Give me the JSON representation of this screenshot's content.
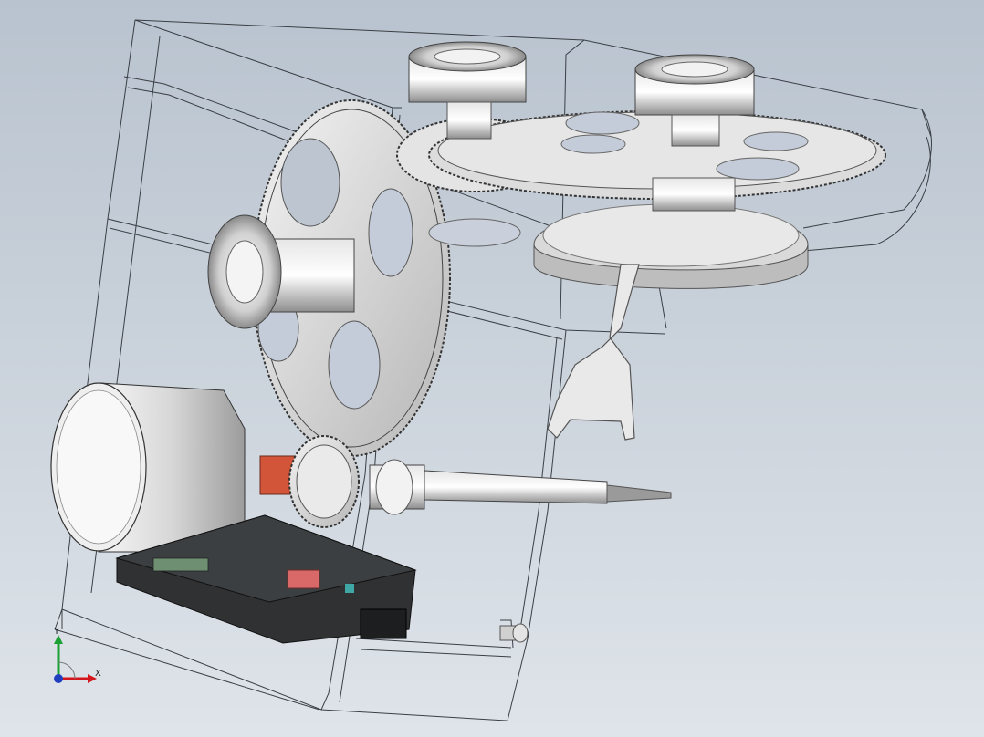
{
  "viewport": {
    "background_top": "#b9c3cf",
    "background_bottom": "#dfe4ea"
  },
  "triad": {
    "x_label": "X",
    "y_label": "Y",
    "x_color": "#d4161c",
    "y_color": "#1aa033",
    "z_color": "#1f3fbf"
  },
  "model": {
    "shaft_coupling_color": "#d2553a",
    "driver_board_color": "#2f3133",
    "connector_color": "#d96868",
    "terminal_color": "#3fa7a5"
  }
}
